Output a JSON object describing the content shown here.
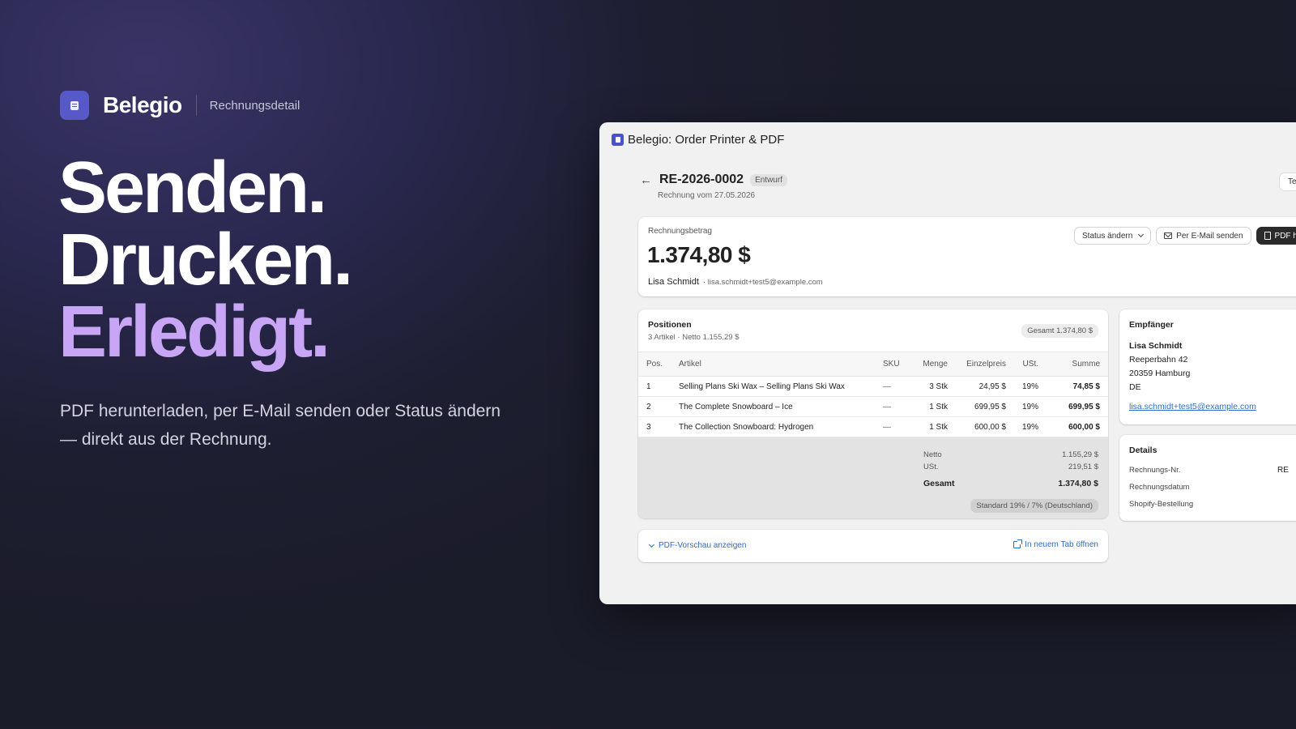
{
  "brand": {
    "name": "Belegio",
    "section": "Rechnungsdetail"
  },
  "headline": {
    "line1": "Senden.",
    "line2": "Drucken.",
    "line3": "Erledigt."
  },
  "subcopy": "PDF herunterladen, per E-Mail senden oder Status ändern — direkt aus der Rechnung.",
  "window": {
    "title": "Belegio: Order Printer & PDF",
    "invoice_number": "RE-2026-0002",
    "status_badge": "Entwurf",
    "invoice_date": "Rechnung vom 27.05.2026",
    "top_right_button": "Te"
  },
  "summary": {
    "label": "Rechnungsbetrag",
    "amount": "1.374,80 $",
    "customer_name": "Lisa Schmidt",
    "customer_email": "· lisa.schmidt+test5@example.com",
    "actions": {
      "status": "Status ändern",
      "email": "Per E-Mail senden",
      "pdf": "PDF her"
    }
  },
  "positions": {
    "title": "Positionen",
    "subtitle": "3 Artikel · Netto 1.155,29 $",
    "total_badge": "Gesamt 1.374,80 $",
    "columns": [
      "Pos.",
      "Artikel",
      "SKU",
      "Menge",
      "Einzelpreis",
      "USt.",
      "Summe"
    ],
    "rows": [
      {
        "pos": "1",
        "article": "Selling Plans Ski Wax – Selling Plans Ski Wax",
        "sku": "—",
        "qty": "3 Stk",
        "price": "24,95 $",
        "tax": "19%",
        "sum": "74,85 $"
      },
      {
        "pos": "2",
        "article": "The Complete Snowboard – Ice",
        "sku": "—",
        "qty": "1 Stk",
        "price": "699,95 $",
        "tax": "19%",
        "sum": "699,95 $"
      },
      {
        "pos": "3",
        "article": "The Collection Snowboard: Hydrogen",
        "sku": "—",
        "qty": "1 Stk",
        "price": "600,00 $",
        "tax": "19%",
        "sum": "600,00 $"
      }
    ],
    "totals": {
      "net_label": "Netto",
      "net_value": "1.155,29 $",
      "tax_label": "USt.",
      "tax_value": "219,51 $",
      "gross_label": "Gesamt",
      "gross_value": "1.374,80 $",
      "tax_badge": "Standard 19% / 7% (Deutschland)"
    }
  },
  "preview": {
    "toggle": "PDF-Vorschau anzeigen",
    "open_new_tab": "In neuem Tab öffnen"
  },
  "recipient": {
    "title": "Empfänger",
    "name": "Lisa Schmidt",
    "street": "Reeperbahn 42",
    "city": "20359 Hamburg",
    "country": "DE",
    "email": "lisa.schmidt+test5@example.com"
  },
  "details": {
    "title": "Details",
    "invoice_no_label": "Rechnungs-Nr.",
    "invoice_no_value": "RE",
    "date_label": "Rechnungsdatum",
    "order_label": "Shopify-Bestellung"
  },
  "colors": {
    "accent_purple": "#c9a6f5",
    "brand_blue": "#5659c7",
    "link_blue": "#2c6ecb"
  },
  "icons": [
    "document-icon",
    "back-arrow-icon",
    "chevron-down-icon",
    "mail-icon",
    "pdf-icon",
    "external-link-icon"
  ]
}
